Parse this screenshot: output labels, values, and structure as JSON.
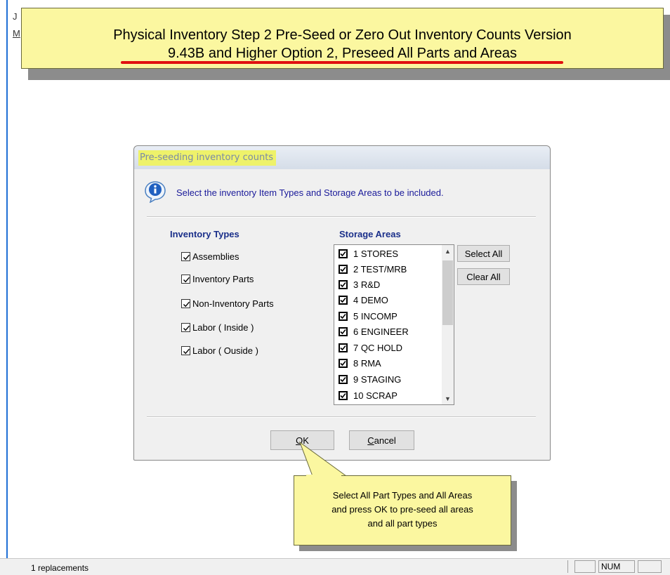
{
  "background": {
    "fragment_top": "J",
    "fragment_mid": "M"
  },
  "title_callout": {
    "line1": "Physical Inventory Step 2 Pre-Seed or Zero Out Inventory Counts Version",
    "line2": "9.43B and Higher Option 2, Preseed All Parts and Areas"
  },
  "dialog": {
    "title": "Pre-seeding  inventory counts",
    "icon": "info-icon",
    "message": "Select the inventory Item Types and Storage Areas to be included.",
    "inventory_types_title": "Inventory Types",
    "inventory_types": [
      {
        "label": "Assemblies",
        "checked": true
      },
      {
        "label": "Inventory Parts",
        "checked": true
      },
      {
        "label": "Non-Inventory Parts",
        "checked": true
      },
      {
        "label": "Labor ( Inside )",
        "checked": true
      },
      {
        "label": "Labor ( Ouside )",
        "checked": true
      }
    ],
    "storage_areas_title": "Storage Areas",
    "storage_areas": [
      {
        "label": "1  STORES",
        "checked": true
      },
      {
        "label": "2  TEST/MRB",
        "checked": true
      },
      {
        "label": "3  R&D",
        "checked": true
      },
      {
        "label": "4  DEMO",
        "checked": true
      },
      {
        "label": "5  INCOMP",
        "checked": true
      },
      {
        "label": "6  ENGINEER",
        "checked": true
      },
      {
        "label": "7  QC HOLD",
        "checked": true
      },
      {
        "label": "8  RMA",
        "checked": true
      },
      {
        "label": "9  STAGING",
        "checked": true
      },
      {
        "label": "10  SCRAP",
        "checked": true
      }
    ],
    "select_all_label": "Select All",
    "clear_all_label": "Clear All",
    "ok_mnemonic": "O",
    "ok_rest": "K",
    "cancel_mnemonic": "C",
    "cancel_rest": "ancel"
  },
  "bottom_callout": {
    "line1": "Select All Part Types and All Areas",
    "line2": "and press OK to pre-seed all areas",
    "line3": "and all part types"
  },
  "status_bar": {
    "text": "1  replacements",
    "num_indicator": "NUM"
  },
  "colors": {
    "callout_fill": "#fbf7a0",
    "title_highlight": "#eef26a",
    "underline_red": "#e01010",
    "label_blue": "#1a2f8a"
  }
}
